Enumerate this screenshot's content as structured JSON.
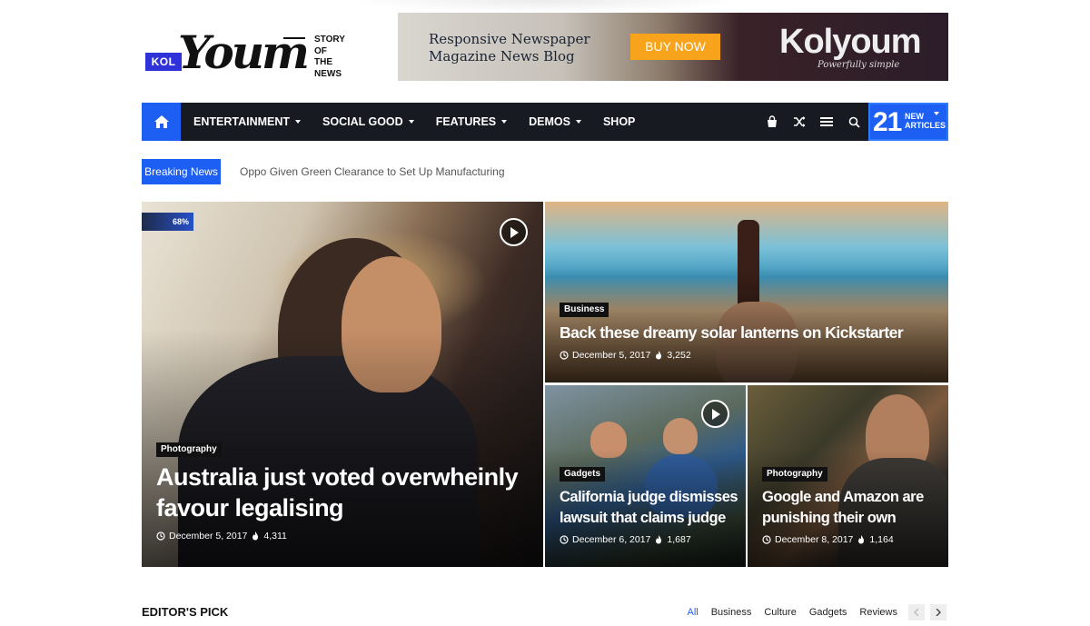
{
  "brand": {
    "badge": "KOL",
    "wordmark": "Youm",
    "tagline": [
      "STORY",
      "OF",
      "THE",
      "NEWS"
    ]
  },
  "banner": {
    "line1": "Responsive Newspaper",
    "line2": "Magazine News Blog",
    "button": "BUY NOW",
    "brand_name": "Kolyoum",
    "brand_sub": "Powerfully simple"
  },
  "nav": {
    "items": [
      {
        "label": "ENTERTAINMENT",
        "dropdown": true
      },
      {
        "label": "SOCIAL GOOD",
        "dropdown": true
      },
      {
        "label": "FEATURES",
        "dropdown": true
      },
      {
        "label": "DEMOS",
        "dropdown": true
      },
      {
        "label": "SHOP",
        "dropdown": false
      }
    ],
    "tools": [
      "shopping-bag-icon",
      "shuffle-icon",
      "menu-icon",
      "search-icon"
    ],
    "new_count": "21",
    "new_label_1": "NEW",
    "new_label_2": "ARTICLES"
  },
  "breaking": {
    "label": "Breaking News",
    "headline": "Oppo Given Green Clearance to Set Up Manufacturing"
  },
  "featured": {
    "main": {
      "percent": "68%",
      "tag": "Photography",
      "title_1": "Australia just voted overwheinly",
      "title_2": "favour legalising",
      "date": "December 5, 2017",
      "views": "4,311"
    },
    "top_right": {
      "tag": "Business",
      "title": "Back these dreamy solar lanterns on Kickstarter",
      "date": "December 5, 2017",
      "views": "3,252"
    },
    "bottom_left": {
      "tag": "Gadgets",
      "title_1": "California judge dismisses",
      "title_2": "lawsuit that claims judge",
      "date": "December 6, 2017",
      "views": "1,687"
    },
    "bottom_right": {
      "tag": "Photography",
      "title_1": "Google and Amazon are",
      "title_2": "punishing their own",
      "date": "December 8, 2017",
      "views": "1,164"
    }
  },
  "editors_pick": {
    "title": "EDITOR'S PICK",
    "tabs": [
      "All",
      "Business",
      "Culture",
      "Gadgets",
      "Reviews"
    ],
    "active_tab": "All"
  },
  "colors": {
    "accent": "#1d5ff2",
    "nav_bg": "#181a21",
    "banner_button": "#f8a31c"
  }
}
